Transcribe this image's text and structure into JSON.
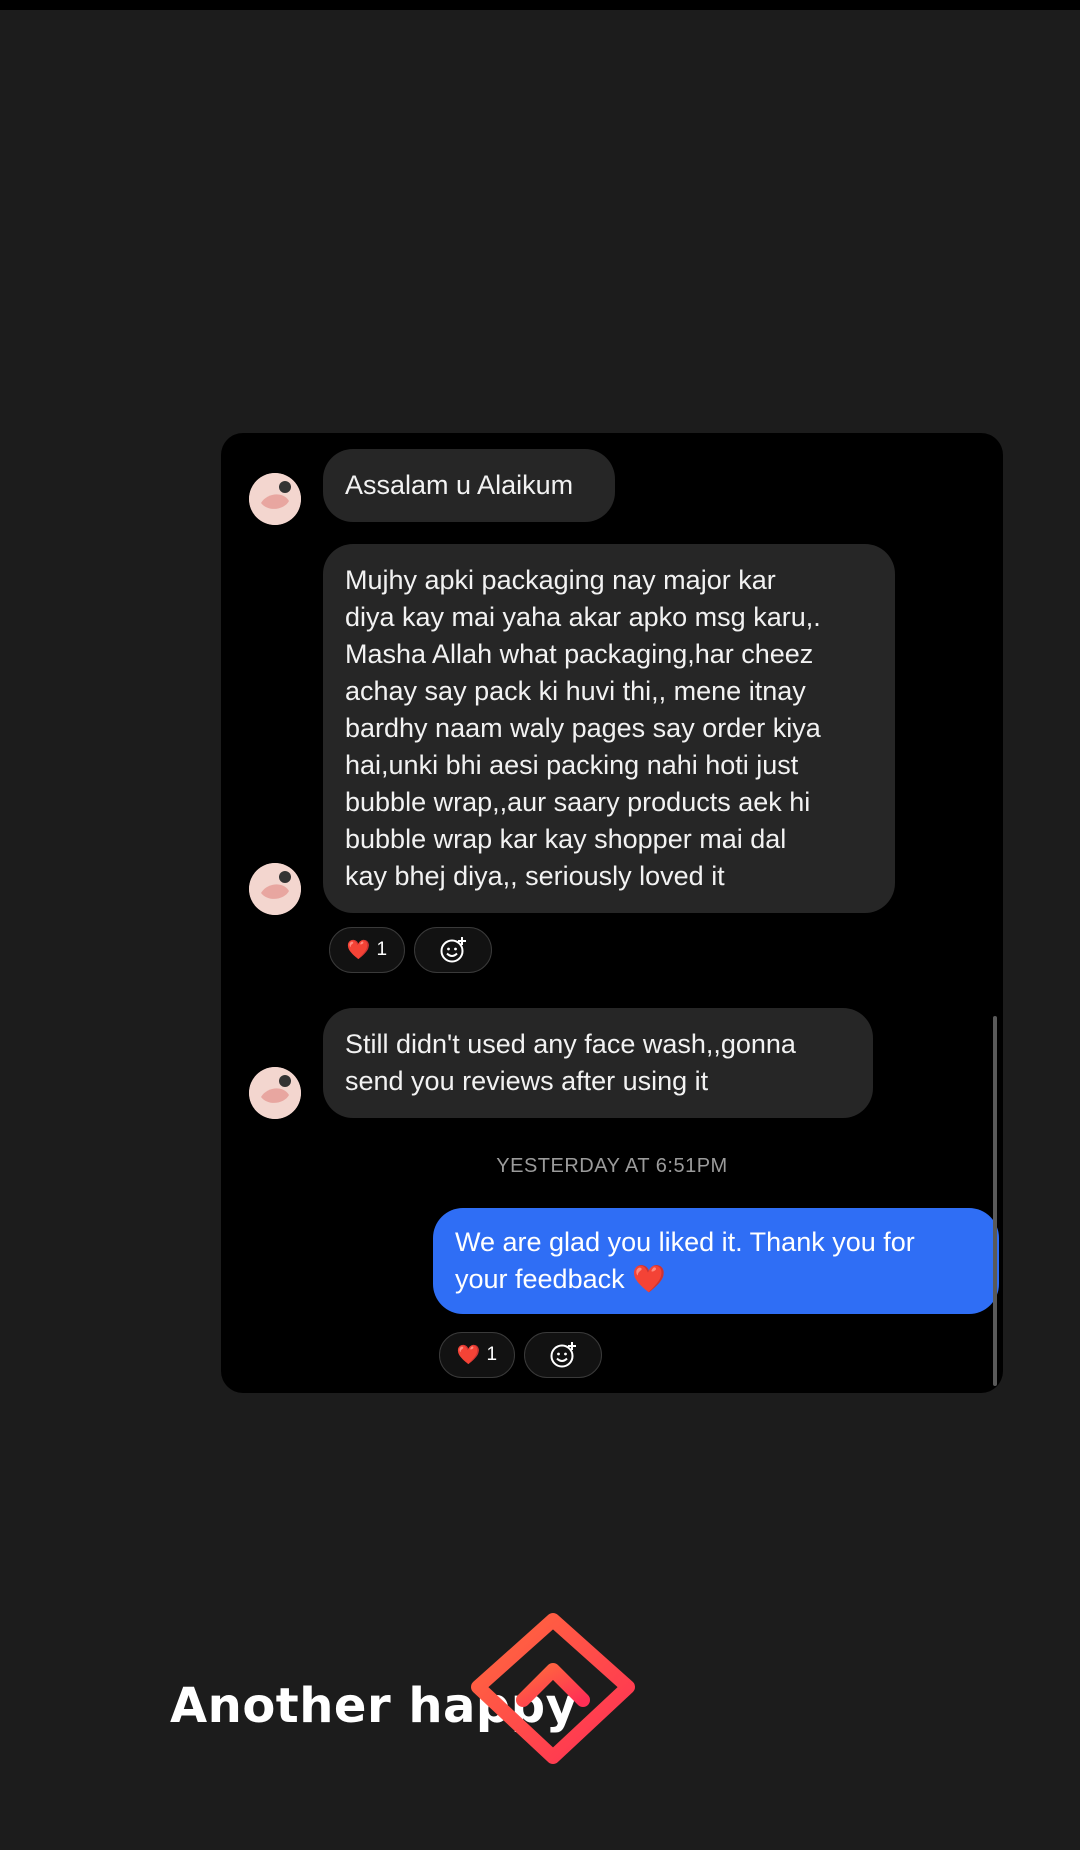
{
  "messages": {
    "incoming": [
      {
        "text": "Assalam u Alaikum"
      },
      {
        "text": "Mujhy apki packaging nay major kar\ndiya kay mai yaha akar apko msg karu,.\nMasha Allah what packaging,har cheez\nachay say pack ki huvi thi,, mene itnay\nbardhy naam waly pages say order kiya\nhai,unki bhi aesi packing nahi hoti just\nbubble wrap,,aur saary products aek hi\nbubble wrap kar kay shopper mai dal\nkay bhej diya,, seriously loved it"
      },
      {
        "text": "Still didn't used any face wash,,gonna\nsend you reviews after using it"
      }
    ],
    "timestamp": "YESTERDAY AT 6:51PM",
    "outgoing": {
      "text": "We are glad you liked it. Thank you for\nyour feedback ❤️"
    }
  },
  "reactions": {
    "incoming": {
      "emoji": "❤️",
      "count": "1"
    },
    "outgoing": {
      "emoji": "❤️",
      "count": "1"
    }
  },
  "caption": {
    "text": "Another happy"
  },
  "icons": [
    "avatar",
    "heart-icon",
    "add-reaction-icon",
    "upload-logo-icon"
  ],
  "colors": {
    "outgoing_bubble": "#2f6ef5",
    "incoming_bubble": "#262626",
    "logo": "#ff4a4a"
  }
}
